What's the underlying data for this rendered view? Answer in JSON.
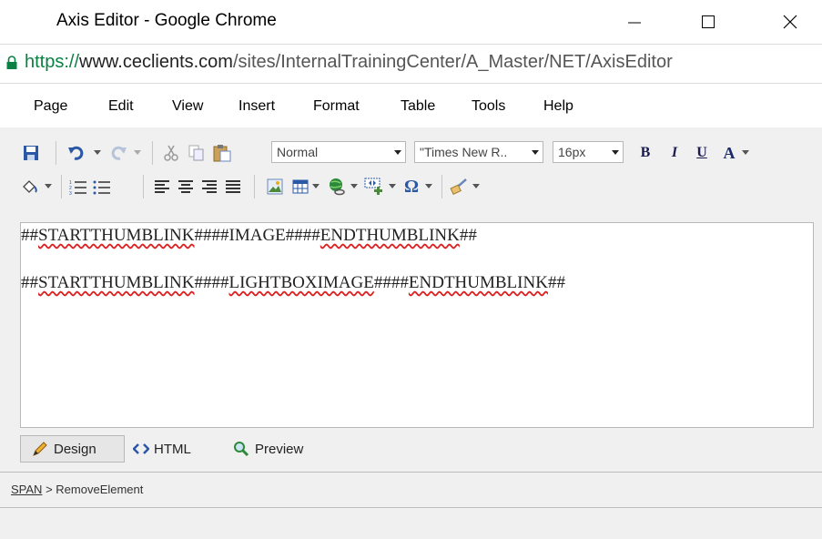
{
  "window": {
    "title": "Axis Editor - Google Chrome",
    "url_scheme": "https://",
    "url_host": "www.ceclients.com",
    "url_path": "/sites/InternalTrainingCenter/A_Master/NET/AxisEditor"
  },
  "menu": {
    "items": [
      "Page",
      "Edit",
      "View",
      "Insert",
      "Format",
      "Table",
      "Tools",
      "Help"
    ]
  },
  "toolbar": {
    "paragraph_style": "Normal",
    "font_name": "\"Times New R..",
    "font_size": "16px",
    "bold_label": "B",
    "italic_label": "I",
    "underline_label": "U",
    "forecolor_label": "A",
    "omega_label": "Ω"
  },
  "editor": {
    "line1": {
      "pre": "##",
      "a": "STARTTHUMBLINK",
      "mid": "####IMAGE####",
      "b": "ENDTHUMBLINK",
      "post": "##"
    },
    "line2": {
      "pre": "##",
      "a": "STARTTHUMBLINK",
      "mid": "####",
      "c": "LIGHTBOXIMAGE",
      "mid2": "####",
      "b": "ENDTHUMBLINK",
      "post": "##"
    }
  },
  "modes": {
    "design": "Design",
    "html": "HTML",
    "preview": "Preview"
  },
  "status": {
    "crumb_link": "SPAN",
    "crumb_sep": ">",
    "crumb_current": "RemoveElement"
  }
}
